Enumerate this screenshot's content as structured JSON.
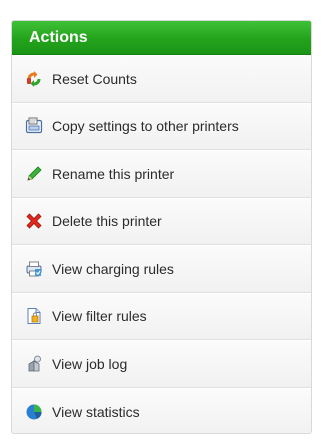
{
  "panel": {
    "title": "Actions",
    "header_color": "#26a51f",
    "items": [
      {
        "label": "Reset Counts",
        "icon": "reset-counts-icon"
      },
      {
        "label": "Copy settings to other printers",
        "icon": "copy-settings-icon"
      },
      {
        "label": "Rename this printer",
        "icon": "rename-pencil-icon"
      },
      {
        "label": "Delete this printer",
        "icon": "delete-x-icon"
      },
      {
        "label": "View charging rules",
        "icon": "charging-rules-icon"
      },
      {
        "label": "View filter rules",
        "icon": "filter-rules-icon"
      },
      {
        "label": "View job log",
        "icon": "job-log-icon"
      },
      {
        "label": "View statistics",
        "icon": "statistics-pie-icon"
      }
    ]
  }
}
